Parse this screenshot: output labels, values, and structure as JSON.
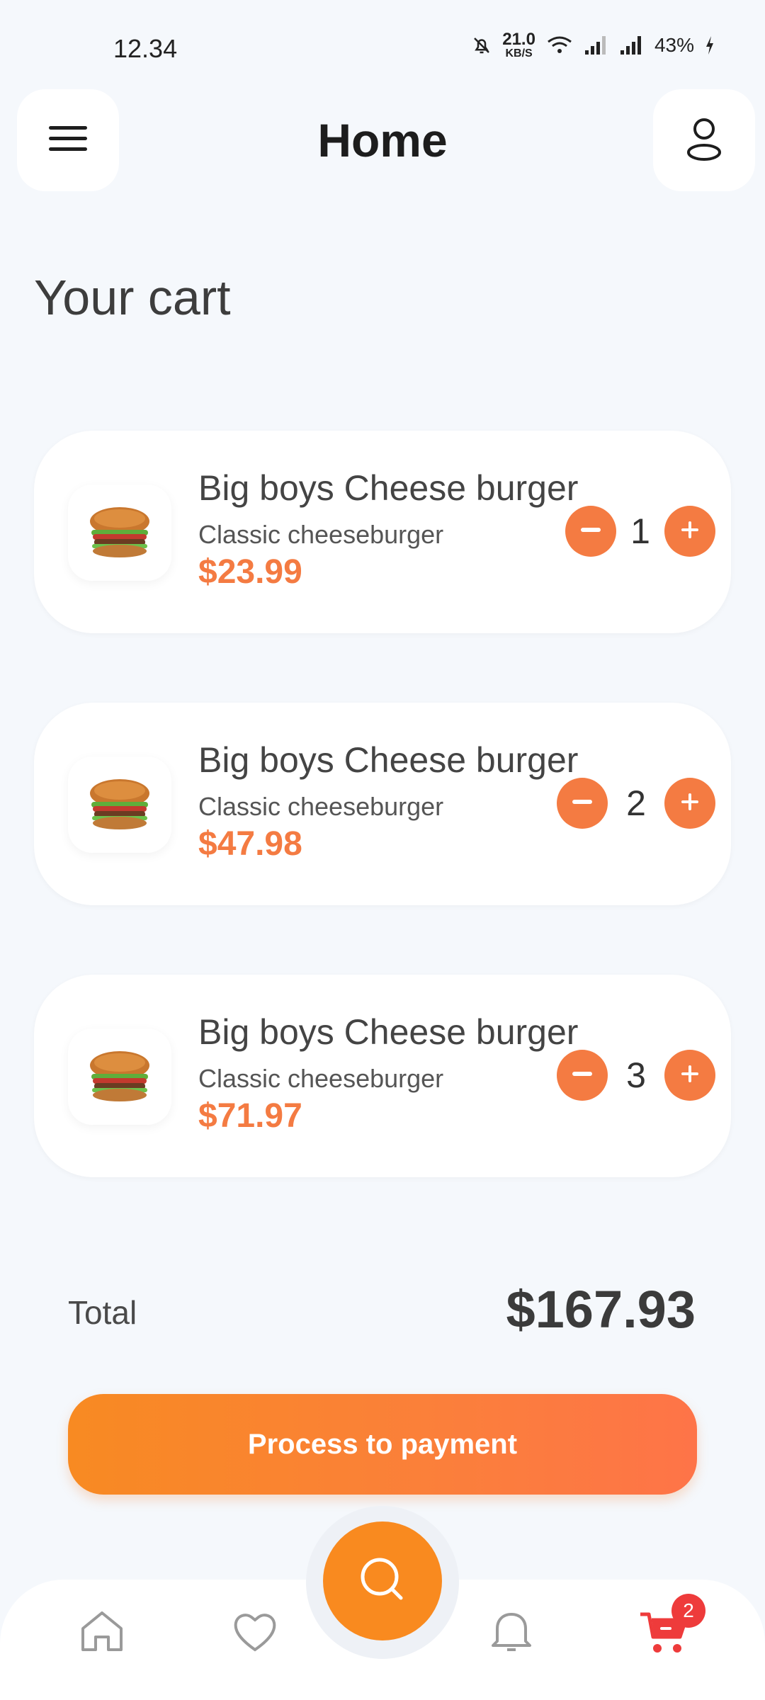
{
  "status_bar": {
    "time": "12.34",
    "net_speed_value": "21.0",
    "net_speed_unit": "KB/S",
    "battery": "43%"
  },
  "header": {
    "title": "Home"
  },
  "cart": {
    "title": "Your cart",
    "items": [
      {
        "name": "Big boys Cheese burger",
        "description": "Classic cheeseburger",
        "price": "$23.99",
        "quantity": "1"
      },
      {
        "name": "Big boys Cheese burger",
        "description": "Classic cheeseburger",
        "price": "$47.98",
        "quantity": "2"
      },
      {
        "name": "Big boys Cheese burger",
        "description": "Classic cheeseburger",
        "price": "$71.97",
        "quantity": "3"
      }
    ],
    "total_label": "Total",
    "total_value": "$167.93",
    "pay_button_label": "Process to payment"
  },
  "bottom_nav": {
    "items": [
      "home-icon",
      "heart-icon",
      "search-icon",
      "bell-icon",
      "cart-icon"
    ],
    "cart_badge": "2"
  },
  "colors": {
    "accent": "#f47b42",
    "fab": "#f98a1f",
    "badge": "#ee3b3b",
    "cart_active": "#ee3b3b"
  }
}
